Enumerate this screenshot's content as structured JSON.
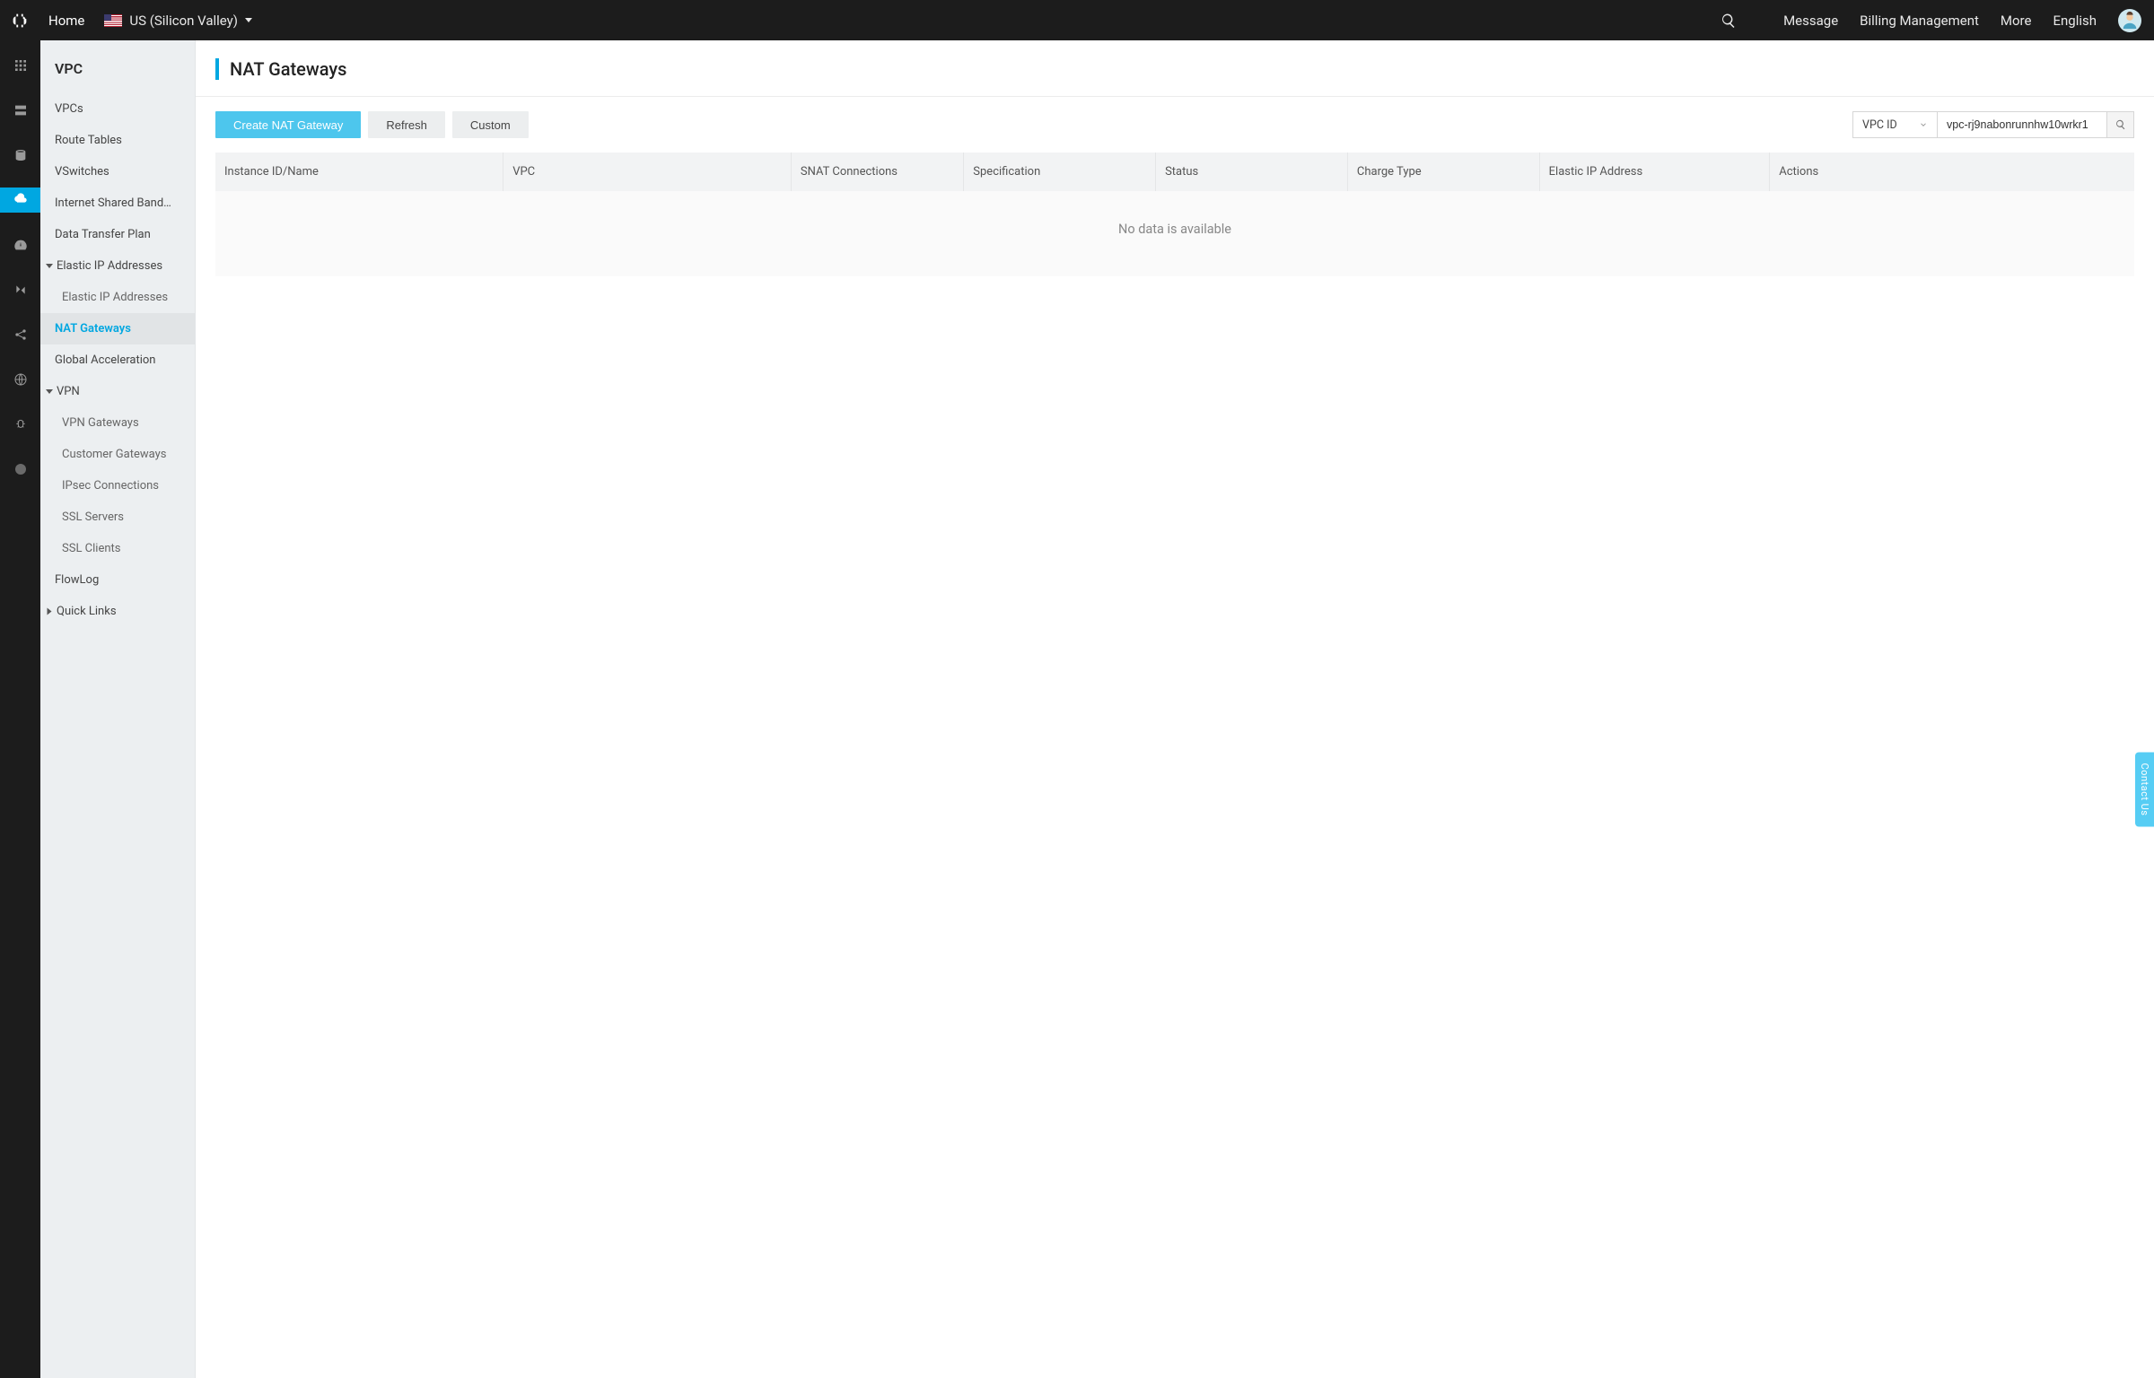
{
  "topbar": {
    "home": "Home",
    "region": "US (Silicon Valley)",
    "links": {
      "message": "Message",
      "billing": "Billing Management",
      "more": "More",
      "language": "English"
    }
  },
  "sidebar": {
    "title": "VPC",
    "items": [
      {
        "label": "VPCs",
        "type": "item"
      },
      {
        "label": "Route Tables",
        "type": "item"
      },
      {
        "label": "VSwitches",
        "type": "item"
      },
      {
        "label": "Internet Shared Band…",
        "type": "item"
      },
      {
        "label": "Data Transfer Plan",
        "type": "item"
      },
      {
        "label": "Elastic IP Addresses",
        "type": "group",
        "open": true
      },
      {
        "label": "Elastic IP Addresses",
        "type": "sub"
      },
      {
        "label": "NAT Gateways",
        "type": "item",
        "active": true
      },
      {
        "label": "Global Acceleration",
        "type": "item"
      },
      {
        "label": "VPN",
        "type": "group",
        "open": true
      },
      {
        "label": "VPN Gateways",
        "type": "sub"
      },
      {
        "label": "Customer Gateways",
        "type": "sub"
      },
      {
        "label": "IPsec Connections",
        "type": "sub"
      },
      {
        "label": "SSL Servers",
        "type": "sub"
      },
      {
        "label": "SSL Clients",
        "type": "sub"
      },
      {
        "label": "FlowLog",
        "type": "item"
      },
      {
        "label": "Quick Links",
        "type": "group",
        "open": false
      }
    ]
  },
  "page": {
    "title": "NAT Gateways",
    "toolbar": {
      "create": "Create NAT Gateway",
      "refresh": "Refresh",
      "custom": "Custom"
    },
    "filter": {
      "field": "VPC ID",
      "value": "vpc-rj9nabonrunnhw10wrkr1"
    },
    "table": {
      "columns": [
        "Instance ID/Name",
        "VPC",
        "SNAT Connections",
        "Specification",
        "Status",
        "Charge Type",
        "Elastic IP Address",
        "Actions"
      ],
      "empty": "No data is available"
    }
  },
  "contact_tab": "Contact Us",
  "rail_icons": [
    "grid-icon",
    "server-icon",
    "cloud-bolt-icon",
    "cloud-arrow-icon",
    "gauge-icon",
    "link-icon",
    "share-nodes-icon",
    "globe-icon",
    "bug-icon",
    "dot-icon"
  ]
}
